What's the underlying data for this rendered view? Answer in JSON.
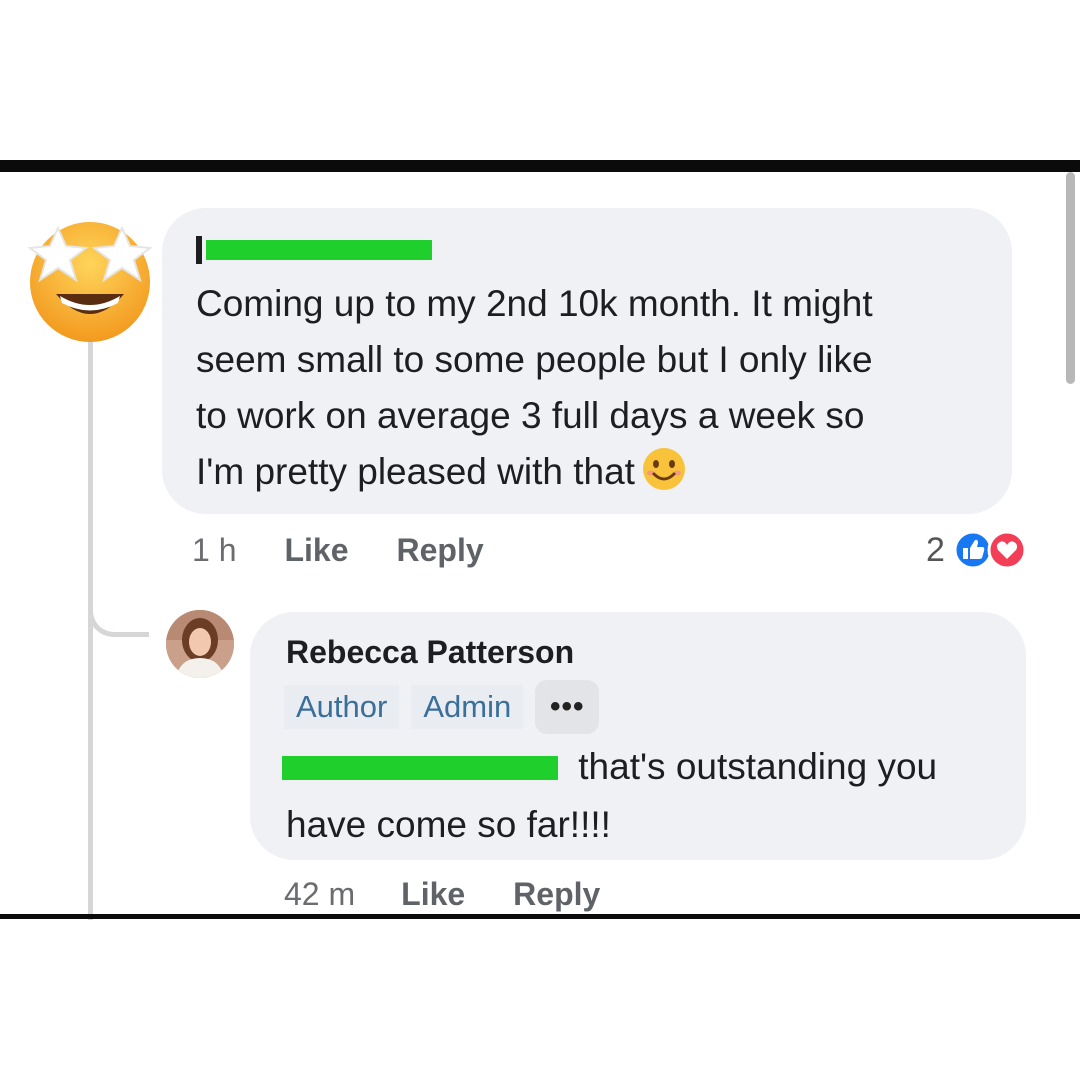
{
  "comment": {
    "text": "Coming up to my 2nd 10k month. It might\nseem small to some people but I only like\nto work on average 3 full days a week so\nI'm pretty pleased with that",
    "time": "1 h",
    "like_label": "Like",
    "reply_label": "Reply",
    "reaction_count": "2",
    "reaction_icons": [
      "like-icon",
      "love-icon"
    ],
    "avatar_icon": "star-struck-emoji-icon",
    "inline_emoji": "smiling-face-icon"
  },
  "reply": {
    "author": "Rebecca Patterson",
    "badges": [
      "Author",
      "Admin"
    ],
    "more_label": "•••",
    "text": " that's outstanding you have come so far!!!!",
    "time": "42 m",
    "like_label": "Like",
    "reply_label": "Reply"
  },
  "colors": {
    "redaction": "#1fcf2c",
    "bubble": "#f0f1f4",
    "like_blue": "#1877f2",
    "love_red": "#f33e58"
  }
}
